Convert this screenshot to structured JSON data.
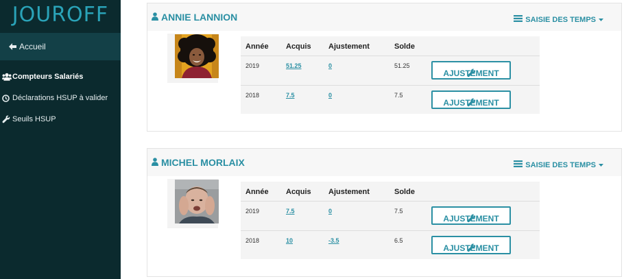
{
  "app": {
    "brand": "JOUROFF"
  },
  "sidebar": {
    "home": {
      "label": "Accueil",
      "icon": "arrow-left-icon"
    },
    "items": [
      {
        "label": "Compteurs Salariés",
        "icon": "users-icon",
        "active": true
      },
      {
        "label": "Déclarations HSUP à valider",
        "icon": "clock-icon",
        "active": false
      },
      {
        "label": "Seuils HSUP",
        "icon": "wrench-icon",
        "active": false
      }
    ]
  },
  "employees": [
    {
      "name": "ANNIE LANNION",
      "saisie_label": "SAISIE DES TEMPS",
      "table": {
        "headers": [
          "Année",
          "Acquis",
          "Ajustement",
          "Solde"
        ],
        "rows": [
          {
            "annee": "2019",
            "acquis": "51.25",
            "ajustement": "0",
            "solde": "51.25",
            "button": "AJUSTEMENT"
          },
          {
            "annee": "2018",
            "acquis": "7.5",
            "ajustement": "0",
            "solde": "7.5",
            "button": "AJUSTEMENT"
          }
        ]
      }
    },
    {
      "name": "MICHEL MORLAIX",
      "saisie_label": "SAISIE DES TEMPS",
      "table": {
        "headers": [
          "Année",
          "Acquis",
          "Ajustement",
          "Solde"
        ],
        "rows": [
          {
            "annee": "2019",
            "acquis": "7.5",
            "ajustement": "0",
            "solde": "7.5",
            "button": "AJUSTEMENT"
          },
          {
            "annee": "2018",
            "acquis": "10",
            "ajustement": "-3.5",
            "solde": "6.5",
            "button": "AJUSTEMENT"
          }
        ]
      }
    }
  ],
  "colors": {
    "sidebar_bg": "#0b2a2e",
    "sidebar_active": "#134047",
    "accent": "#2a8fa3",
    "panel_head": "#f7f7f7"
  }
}
